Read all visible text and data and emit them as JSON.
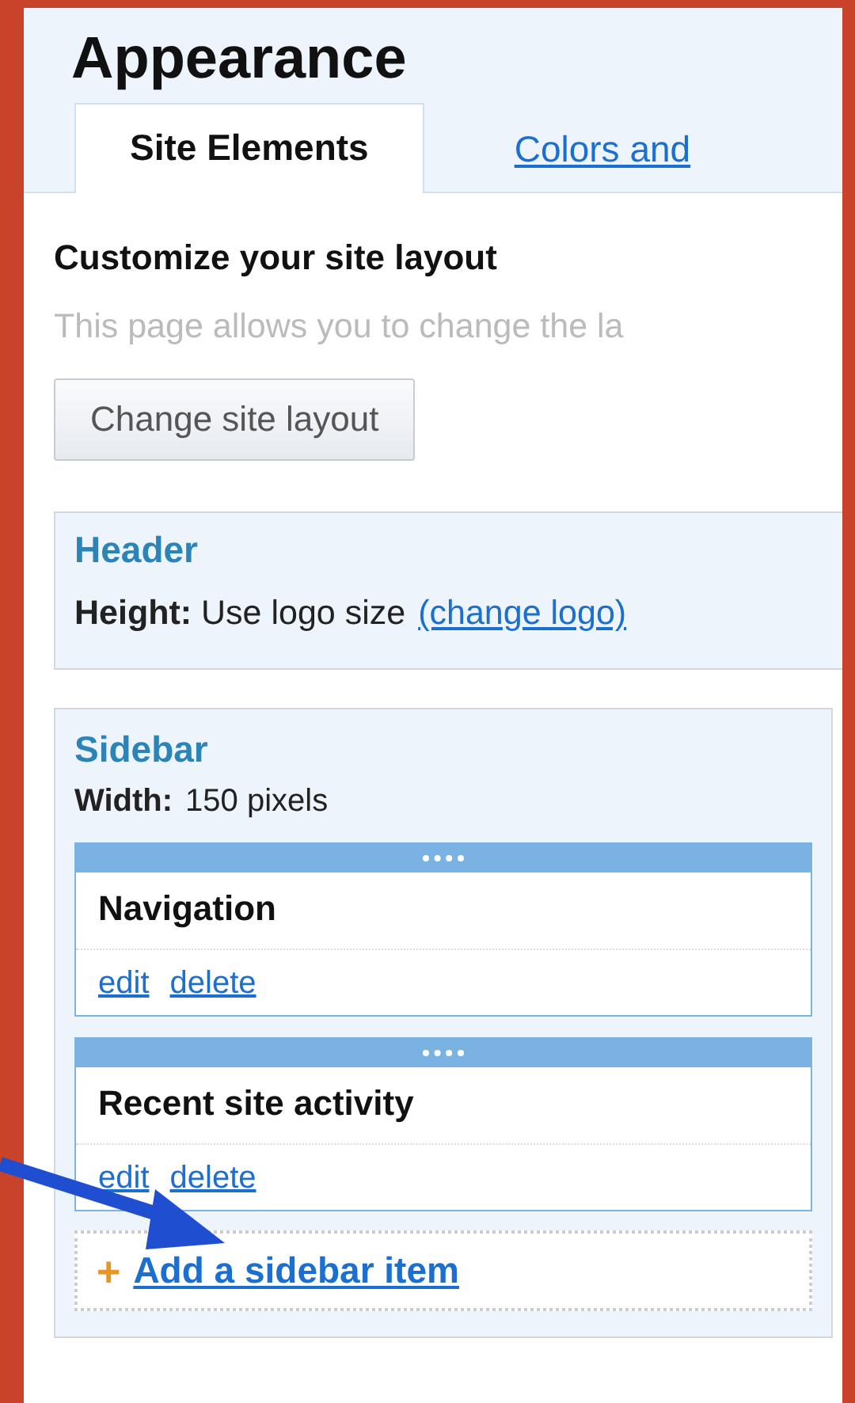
{
  "title": "Appearance",
  "tabs": [
    {
      "label": "Site Elements",
      "selected": true
    },
    {
      "label": "Colors and",
      "selected": false
    }
  ],
  "heading": "Customize your site layout",
  "description": "This page allows you to change the la",
  "layout_button": "Change site layout",
  "header_box": {
    "title": "Header",
    "label": "Height:",
    "value": "Use logo size",
    "link": "(change logo)"
  },
  "sidebar_box": {
    "title": "Sidebar",
    "label": "Width:",
    "value": "150 pixels",
    "items": [
      {
        "name": "Navigation",
        "actions": [
          "edit",
          "delete"
        ]
      },
      {
        "name": "Recent site activity",
        "actions": [
          "edit",
          "delete"
        ]
      }
    ],
    "add_icon": "+",
    "add_link": "Add a sidebar item"
  }
}
